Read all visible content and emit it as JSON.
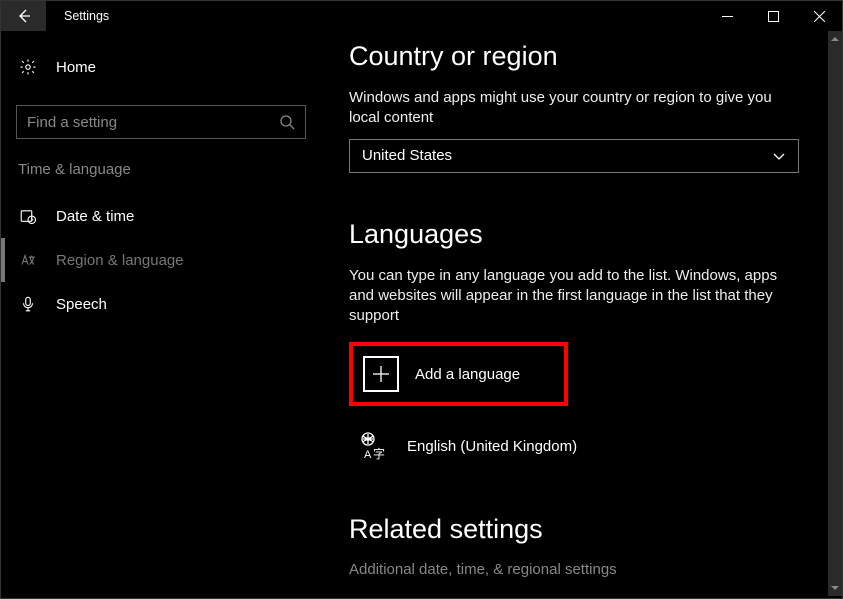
{
  "title": "Settings",
  "sidebar": {
    "home": "Home",
    "search_placeholder": "Find a setting",
    "section": "Time & language",
    "items": [
      {
        "label": "Date & time"
      },
      {
        "label": "Region & language"
      },
      {
        "label": "Speech"
      }
    ]
  },
  "country": {
    "heading": "Country or region",
    "desc": "Windows and apps might use your country or region to give you local content",
    "selected": "United States"
  },
  "languages": {
    "heading": "Languages",
    "desc": "You can type in any language you add to the list. Windows, apps and websites will appear in the first language in the list that they support",
    "add": "Add a language",
    "items": [
      {
        "label": "English (United Kingdom)"
      }
    ]
  },
  "related": {
    "heading": "Related settings",
    "link": "Additional date, time, & regional settings"
  }
}
